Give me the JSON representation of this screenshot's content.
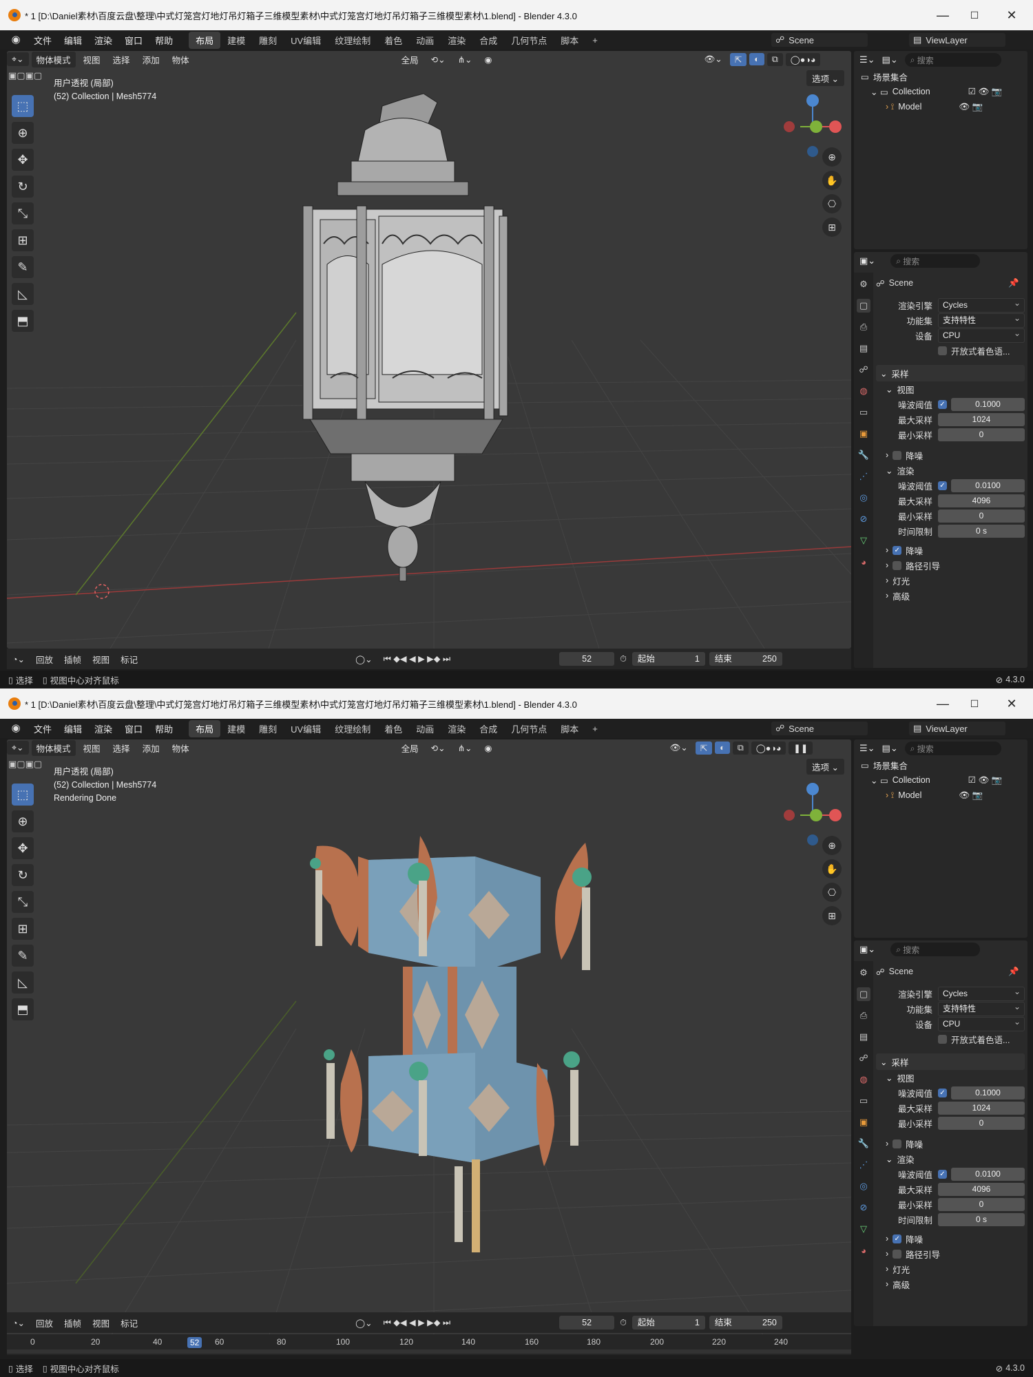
{
  "window_title": "* 1 [D:\\Daniel素材\\百度云盘\\整理\\中式灯笼宫灯地灯吊灯箱子三维模型素材\\中式灯笼宫灯地灯吊灯箱子三维模型素材\\1.blend] - Blender 4.3.0",
  "menu": [
    "文件",
    "编辑",
    "渲染",
    "窗口",
    "帮助"
  ],
  "workspaces": [
    "布局",
    "建模",
    "雕刻",
    "UV编辑",
    "纹理绘制",
    "着色",
    "动画",
    "渲染",
    "合成",
    "几何节点",
    "脚本"
  ],
  "active_workspace": "布局",
  "scene_name": "Scene",
  "view_layer": "ViewLayer",
  "viewport": {
    "mode": "物体模式",
    "menus": [
      "视图",
      "选择",
      "添加",
      "物体"
    ],
    "transform_orientation": "全局",
    "options_label": "选项",
    "info_line1": "用户透视 (局部)",
    "info_line2": "(52) Collection | Mesh5774",
    "render_status": "Rendering Done"
  },
  "outliner": {
    "search_placeholder": "搜索",
    "scene_collection": "场景集合",
    "collection": "Collection",
    "model": "Model"
  },
  "properties": {
    "search_placeholder": "搜索",
    "scene": "Scene",
    "render_engine_label": "渲染引擎",
    "render_engine": "Cycles",
    "feature_set_label": "功能集",
    "feature_set": "支持特性",
    "device_label": "设备",
    "device": "CPU",
    "osl_label": "开放式着色语...",
    "sampling": "采样",
    "viewport_sub": "视图",
    "render_sub": "渲染",
    "noise_threshold_label": "噪波阈值",
    "max_samples_label": "最大采样",
    "min_samples_label": "最小采样",
    "time_limit_label": "时间限制",
    "viewport_noise": "0.1000",
    "viewport_max": "1024",
    "viewport_min": "0",
    "render_noise": "0.0100",
    "render_max": "4096",
    "render_min": "0",
    "render_time": "0 s",
    "denoise": "降噪",
    "path_guiding": "路径引导",
    "lights": "灯光",
    "advanced": "高级"
  },
  "timeline": {
    "menus": [
      "回放",
      "插帧",
      "视图",
      "标记"
    ],
    "current_frame": "52",
    "start_label": "起始",
    "start": "1",
    "end_label": "结束",
    "end": "250",
    "ruler": [
      "0",
      "20",
      "40",
      "52",
      "60",
      "80",
      "100",
      "120",
      "140",
      "160",
      "180",
      "200",
      "220",
      "240"
    ]
  },
  "status": {
    "select": "选择",
    "center_view": "视图中心对齐鼠标",
    "version": "4.3.0"
  },
  "colors": {
    "accent": "#4772b3",
    "viewport_bg": "#393939",
    "lantern_blue": "#6e93ad",
    "lantern_orange": "#b8714e",
    "lantern_jade": "#4aa387"
  }
}
